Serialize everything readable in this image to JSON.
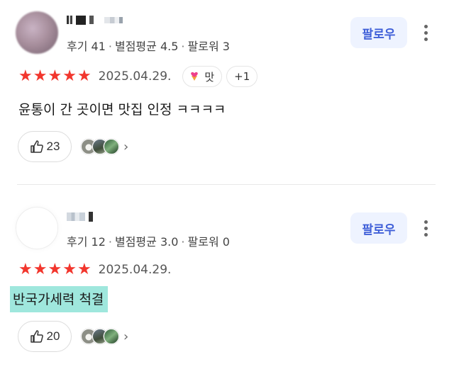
{
  "reviews": [
    {
      "stats": {
        "reviews": "후기 41",
        "avg": "별점평균 4.5",
        "followers": "팔로워 3"
      },
      "follow_label": "팔로우",
      "rating": 5,
      "date": "2025.04.29.",
      "tag": {
        "label": "맛",
        "icon": "heart-icecream-icon"
      },
      "extra_tags": "+1",
      "text": "윤통이 간 곳이면 맛집 인정 ㅋㅋㅋㅋ",
      "likes": "23",
      "highlighted": false
    },
    {
      "stats": {
        "reviews": "후기 12",
        "avg": "별점평균 3.0",
        "followers": "팔로워 0"
      },
      "follow_label": "팔로우",
      "rating": 5,
      "date": "2025.04.29.",
      "text": "반국가세력 척결",
      "likes": "20",
      "highlighted": true
    }
  ],
  "colors": {
    "star": "#f2362d",
    "follow_bg": "#eef3ff",
    "follow_text": "#3f5fd8",
    "highlight": "#9fe7dd"
  },
  "separators": {
    "dot": "·"
  },
  "icons": {
    "star": "★",
    "chevron": "›"
  }
}
